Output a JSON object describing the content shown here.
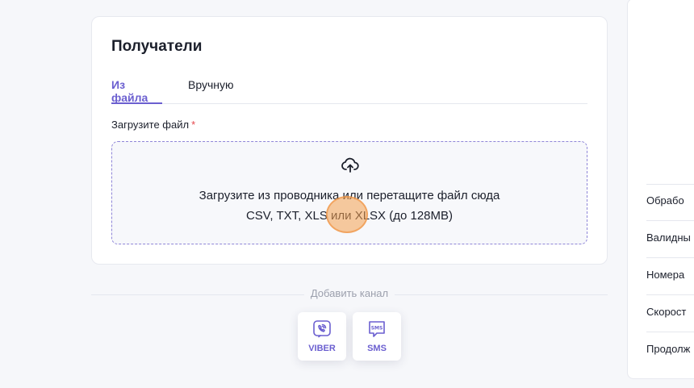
{
  "recipients": {
    "title": "Получатели",
    "tabs": [
      {
        "label": "Из файла",
        "active": true
      },
      {
        "label": "Вручную",
        "active": false
      }
    ],
    "upload_label": "Загрузите файл",
    "required_mark": "*",
    "dropzone": {
      "icon": "cloud-upload-icon",
      "line1": "Загрузите из проводника или перетащите файл сюда",
      "line2": "CSV, TXT, XLS или XLSX (до 128MB)"
    }
  },
  "channels": {
    "label": "Добавить канал",
    "items": [
      {
        "label": "VIBER",
        "icon": "viber-icon"
      },
      {
        "label": "SMS",
        "icon": "sms-icon"
      }
    ]
  },
  "side_panel": {
    "items": [
      {
        "label": "Обрабо"
      },
      {
        "label": "Валидны"
      },
      {
        "label": "Номера"
      },
      {
        "label": "Скорост"
      },
      {
        "label": "Продолж"
      }
    ]
  },
  "colors": {
    "accent": "#6b5fd0",
    "required": "#e5484d",
    "background": "#f6f7fa"
  }
}
